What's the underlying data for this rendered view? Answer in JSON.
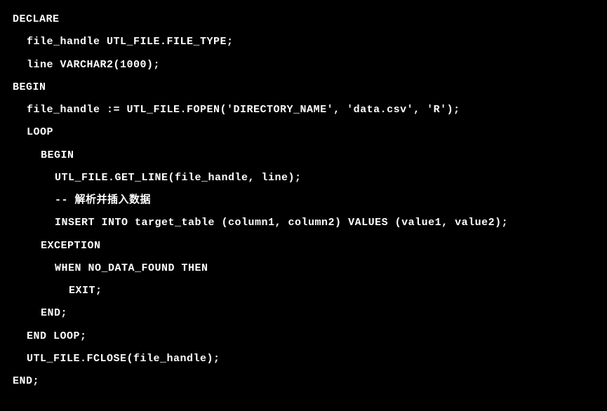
{
  "code": {
    "lines": [
      {
        "text": "DECLARE",
        "indent": 0
      },
      {
        "text": "file_handle UTL_FILE.FILE_TYPE;",
        "indent": 1
      },
      {
        "text": "line VARCHAR2(1000);",
        "indent": 1
      },
      {
        "text": "BEGIN",
        "indent": 0
      },
      {
        "text": "file_handle := UTL_FILE.FOPEN('DIRECTORY_NAME', 'data.csv', 'R');",
        "indent": 1
      },
      {
        "text": "LOOP",
        "indent": 1
      },
      {
        "text": "BEGIN",
        "indent": 2
      },
      {
        "text": "UTL_FILE.GET_LINE(file_handle, line);",
        "indent": 3
      },
      {
        "text": "-- 解析并插入数据",
        "indent": 3
      },
      {
        "text": "INSERT INTO target_table (column1, column2) VALUES (value1, value2);",
        "indent": 3
      },
      {
        "text": "EXCEPTION",
        "indent": 2
      },
      {
        "text": "WHEN NO_DATA_FOUND THEN",
        "indent": 3
      },
      {
        "text": "EXIT;",
        "indent": 4
      },
      {
        "text": "END;",
        "indent": 2
      },
      {
        "text": "END LOOP;",
        "indent": 1
      },
      {
        "text": "UTL_FILE.FCLOSE(file_handle);",
        "indent": 1
      },
      {
        "text": "END;",
        "indent": 0
      }
    ]
  }
}
